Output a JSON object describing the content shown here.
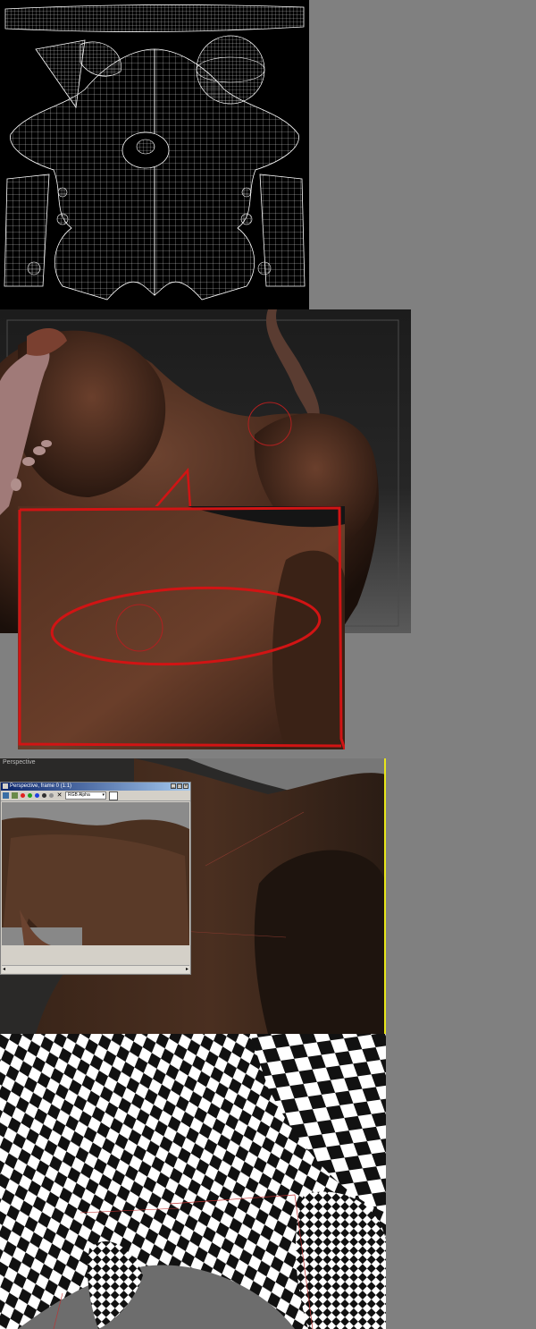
{
  "render_window": {
    "title": "Perspective, frame 0 (1:1)",
    "channel_select": "RGB Alpha",
    "buttons": [
      "save-icon",
      "copy-icon",
      "red-channel",
      "green-channel",
      "blue-channel",
      "alpha-channel",
      "mono-channel",
      "clear-icon"
    ]
  },
  "viewport_label": "Perspective",
  "colors": {
    "annotation": "#d11414",
    "viewport_border": "#e8e51a",
    "uv_wire": "#e8e8e8",
    "skin": "#5a3624",
    "background": "#808080"
  }
}
